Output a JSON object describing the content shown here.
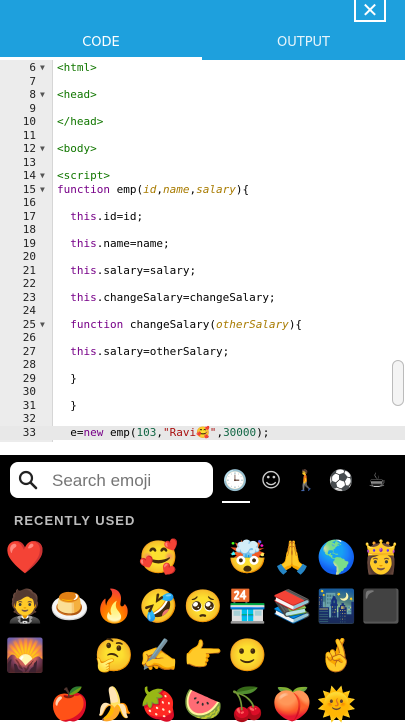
{
  "topbar": {
    "close_glyph": "✕",
    "tabs": [
      {
        "label": "CODE"
      },
      {
        "label": "OUTPUT"
      }
    ]
  },
  "editor": {
    "lines": [
      {
        "n": "6",
        "fold": true,
        "html": "<span class='tag'>&lt;html&gt;</span>"
      },
      {
        "n": "7",
        "fold": false,
        "html": ""
      },
      {
        "n": "8",
        "fold": true,
        "html": "<span class='tag'>&lt;head&gt;</span>"
      },
      {
        "n": "9",
        "fold": false,
        "html": ""
      },
      {
        "n": "10",
        "fold": false,
        "html": "<span class='tag'>&lt;/head&gt;</span>"
      },
      {
        "n": "11",
        "fold": false,
        "html": ""
      },
      {
        "n": "12",
        "fold": true,
        "html": "<span class='tag'>&lt;body&gt;</span>"
      },
      {
        "n": "13",
        "fold": false,
        "html": ""
      },
      {
        "n": "14",
        "fold": true,
        "html": "<span class='tag'>&lt;script&gt;</span>"
      },
      {
        "n": "15",
        "fold": true,
        "html": "<span class='kw'>function</span> emp(<span class='param'>id</span>,<span class='param'>name</span>,<span class='param'>salary</span>){"
      },
      {
        "n": "16",
        "fold": false,
        "html": ""
      },
      {
        "n": "17",
        "fold": false,
        "html": "  <span class='kw'>this</span>.id=id;"
      },
      {
        "n": "18",
        "fold": false,
        "html": ""
      },
      {
        "n": "19",
        "fold": false,
        "html": "  <span class='kw'>this</span>.name=name;"
      },
      {
        "n": "20",
        "fold": false,
        "html": ""
      },
      {
        "n": "21",
        "fold": false,
        "html": "  <span class='kw'>this</span>.salary=salary;"
      },
      {
        "n": "22",
        "fold": false,
        "html": ""
      },
      {
        "n": "23",
        "fold": false,
        "html": "  <span class='kw'>this</span>.changeSalary=changeSalary;"
      },
      {
        "n": "24",
        "fold": false,
        "html": ""
      },
      {
        "n": "25",
        "fold": true,
        "html": "  <span class='kw'>function</span> changeSalary(<span class='param'>otherSalary</span>){"
      },
      {
        "n": "26",
        "fold": false,
        "html": ""
      },
      {
        "n": "27",
        "fold": false,
        "html": "  <span class='kw'>this</span>.salary=otherSalary;"
      },
      {
        "n": "28",
        "fold": false,
        "html": ""
      },
      {
        "n": "29",
        "fold": false,
        "html": "  }"
      },
      {
        "n": "30",
        "fold": false,
        "html": ""
      },
      {
        "n": "31",
        "fold": false,
        "html": "  }"
      },
      {
        "n": "32",
        "fold": false,
        "html": ""
      },
      {
        "n": "33",
        "fold": false,
        "html": "  e=<span class='kw'>new</span> emp(<span class='num'>103</span>,<span class='str'>\"Ravi🥰\"</span>,<span class='num'>30000</span>);"
      }
    ],
    "active_line_index": 27
  },
  "emoji_keyboard": {
    "search_placeholder": "Search emoji",
    "categories": [
      {
        "name": "recent-clock-icon",
        "glyph": "🕒"
      },
      {
        "name": "smileys-icon",
        "glyph": "☺"
      },
      {
        "name": "people-icon",
        "glyph": "🚶"
      },
      {
        "name": "activities-icon",
        "glyph": "⚽"
      },
      {
        "name": "objects-icon",
        "glyph": "☕"
      }
    ],
    "section_label": "RECENTLY USED",
    "emojis": [
      [
        "❤️",
        "😘",
        "😍",
        "🥰",
        "😳",
        "🤯",
        "🙏",
        "🌎",
        "👸"
      ],
      [
        "🤵",
        "🍮",
        "🔥",
        "🤣",
        "🥺",
        "🏪",
        "📚",
        "🌃",
        "⬛"
      ],
      [
        "🌄",
        "😅",
        "🤔",
        "✍️",
        "👉",
        "🙂",
        "😴",
        "🤞",
        "😁"
      ],
      [
        "😊",
        "🍎",
        "🍌",
        "🍓",
        "🍉",
        "🍒",
        "🍑",
        "🌞",
        "😃"
      ]
    ]
  }
}
